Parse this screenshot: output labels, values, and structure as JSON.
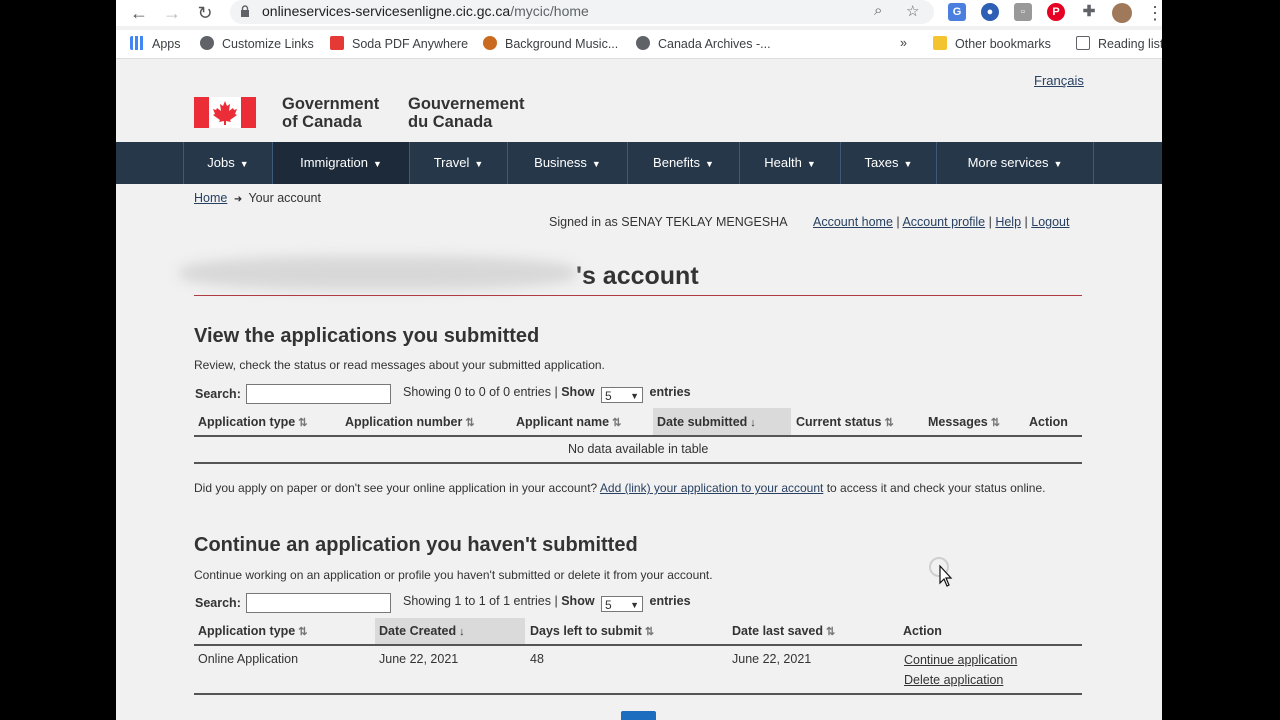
{
  "browser": {
    "url_host": "onlineservices-servicesenligne.cic.gc.ca",
    "url_path": "/mycic/home",
    "bookmarks": [
      "Apps",
      "Customize Links",
      "Soda PDF Anywhere",
      "Background Music...",
      "Canada Archives -...",
      "Other bookmarks",
      "Reading list"
    ],
    "overflow": "»"
  },
  "header": {
    "language_link": "Français",
    "signature_en": "Government\nof Canada",
    "signature_fr": "Gouvernement\ndu Canada"
  },
  "menu": [
    "Jobs",
    "Immigration",
    "Travel",
    "Business",
    "Benefits",
    "Health",
    "Taxes",
    "More services"
  ],
  "breadcrumb": {
    "home": "Home",
    "arrow": "➜",
    "current": "Your account"
  },
  "signed_in": "Signed in as SENAY TEKLAY MENGESHA",
  "account_links": [
    "Account home",
    "Account profile",
    "Help",
    "Logout"
  ],
  "page_title": "'s account",
  "submitted": {
    "title": "View the applications you submitted",
    "description": "Review, check the status or read messages about your submitted application.",
    "search_label": "Search:",
    "showing": "Showing 0 to 0 of 0 entries |",
    "show_label": "Show",
    "show_value": "5",
    "entries_label": "entries",
    "columns": [
      "Application type",
      "Application number",
      "Applicant name",
      "Date submitted",
      "Current status",
      "Messages",
      "Action"
    ],
    "empty_text": "No data available in table",
    "paper_text": "Did you apply on paper or don't see your online application in your account?",
    "paper_link": "Add (link) your application to your account",
    "paper_tail": "to access it and check your status online."
  },
  "unsubmitted": {
    "title": "Continue an application you haven't submitted",
    "description": "Continue working on an application or profile you haven't submitted or delete it from your account.",
    "search_label": "Search:",
    "showing": "Showing 1 to 1 of 1 entries |",
    "show_label": "Show",
    "show_value": "5",
    "entries_label": "entries",
    "columns": [
      "Application type",
      "Date Created",
      "Days left to submit",
      "Date last saved",
      "Action"
    ],
    "rows": [
      {
        "type": "Online Application",
        "created": "June 22, 2021",
        "days_left": "48",
        "last_saved": "June 22, 2021",
        "continue": "Continue application",
        "delete": "Delete application"
      }
    ]
  }
}
